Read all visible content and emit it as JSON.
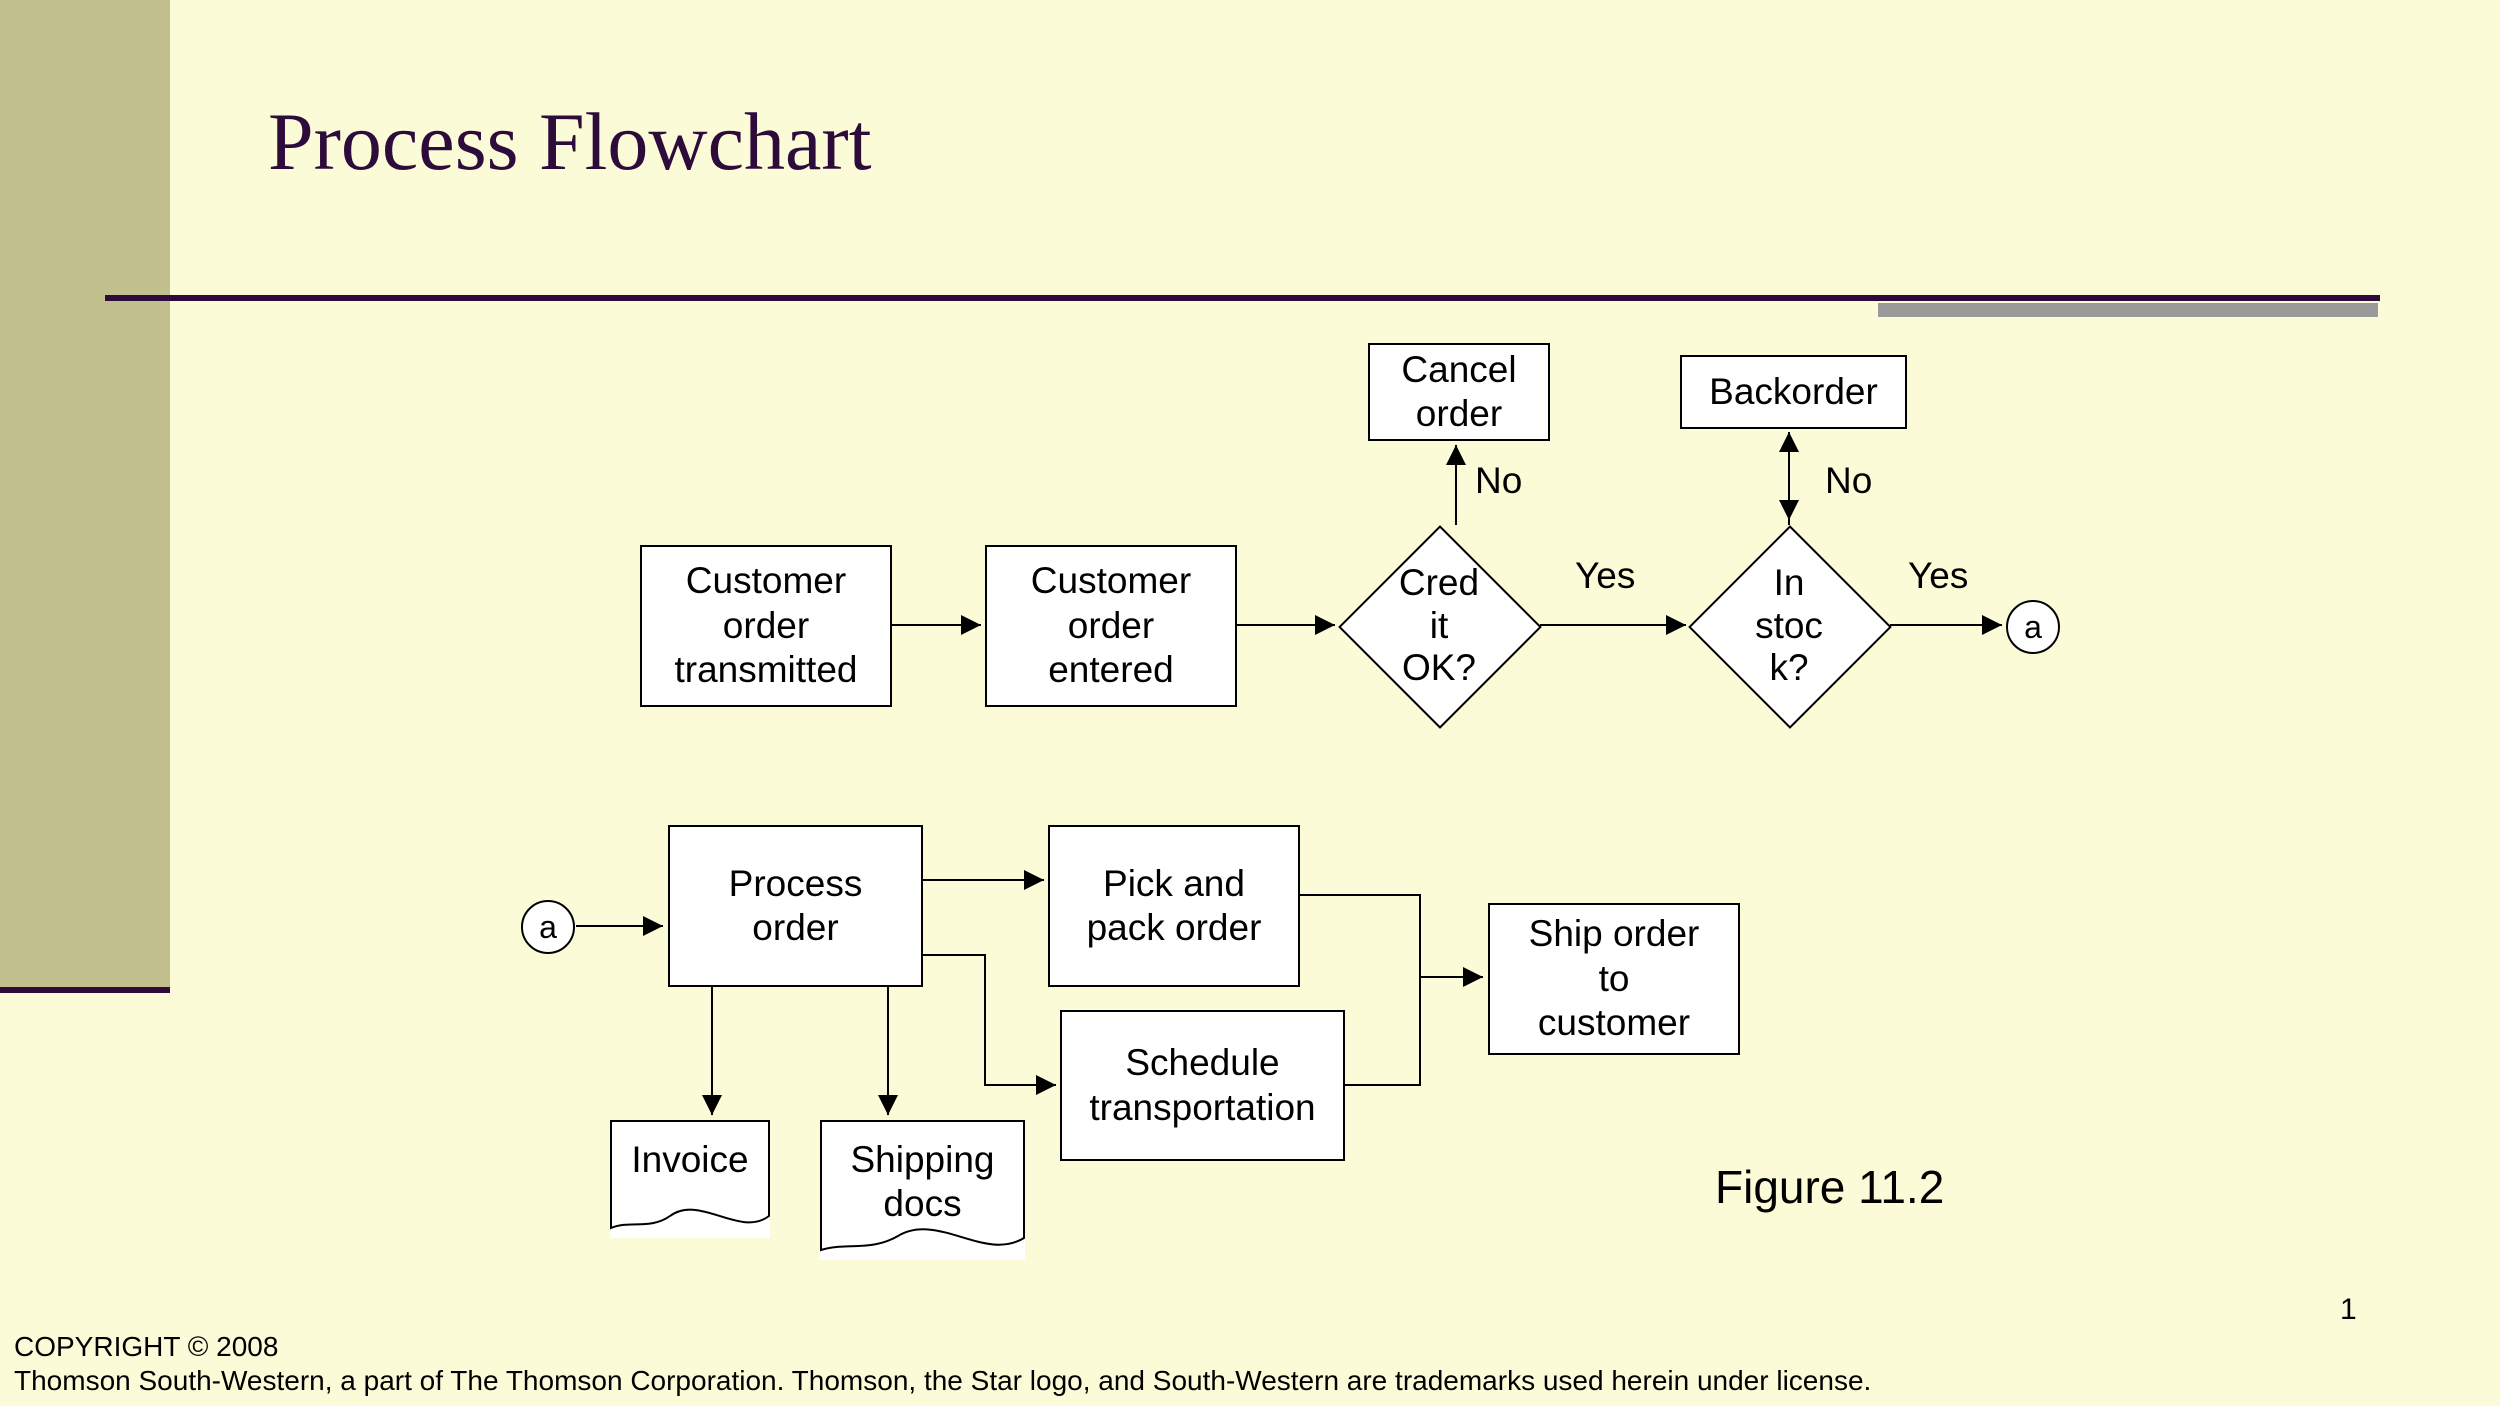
{
  "title": "Process Flowchart",
  "figure": "Figure 11.2",
  "page": "1",
  "copyright_line1": "COPYRIGHT © 2008",
  "copyright_line2": "Thomson South-Western, a part of The Thomson Corporation. Thomson, the Star logo, and South-Western are trademarks used herein under license.",
  "nodes": {
    "order_transmitted": "Customer\norder\ntransmitted",
    "order_entered": "Customer\norder\nentered",
    "credit_ok": "Cred\nit\nOK?",
    "in_stock": "In\nstoc\nk?",
    "cancel": "Cancel\norder",
    "backorder": "Backorder",
    "process_order": "Process\norder",
    "pick_pack": "Pick and\npack order",
    "schedule_trans": "Schedule\ntransportation",
    "ship": "Ship order\nto\ncustomer",
    "invoice": "Invoice",
    "shipping_docs": "Shipping\ndocs",
    "connector_a": "a"
  },
  "labels": {
    "no1": "No",
    "yes1": "Yes",
    "no2": "No",
    "yes2": "Yes"
  }
}
